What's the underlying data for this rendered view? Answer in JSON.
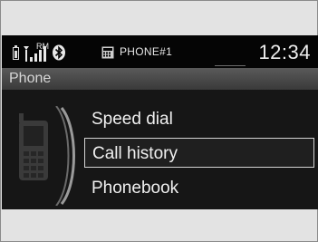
{
  "status_bar": {
    "signal_label": "RM",
    "phone_name": "PHONE#1",
    "time": "12:34"
  },
  "title": "Phone",
  "menu": {
    "items": [
      {
        "label": "Speed dial",
        "selected": false
      },
      {
        "label": "Call history",
        "selected": true
      },
      {
        "label": "Phonebook",
        "selected": false
      }
    ]
  },
  "icons": {
    "battery": "battery-icon",
    "signal": "signal-strength-icon",
    "bluetooth": "bluetooth-icon",
    "phone_small": "phone-icon",
    "device": "mobile-phone-icon"
  }
}
